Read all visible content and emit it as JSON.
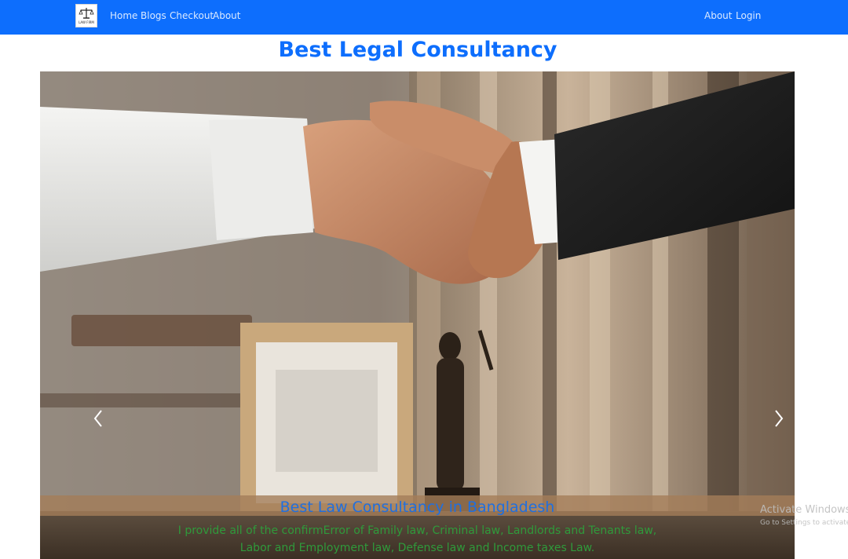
{
  "navbar": {
    "logo_text": "LAW FIRM",
    "left_links": [
      "Home",
      "Blogs",
      "Checkout",
      "About"
    ],
    "right_links": [
      "About",
      "Login"
    ],
    "color": "#0d6efd"
  },
  "main": {
    "page_title": "Best Legal Consultancy"
  },
  "carousel": {
    "image_description": "handshake-over-office-desk-photo",
    "prev_icon": "chevron-left-icon",
    "next_icon": "chevron-right-icon",
    "caption_title": "Best Law Consultancy in Bangladesh",
    "caption_text": "I provide all of the confirmError of Family law, Criminal law, Landlords and Tenants law, Labor and Employment law, Defense law and Income taxes Law.",
    "caption_title_color": "#1f6fe0",
    "caption_text_color": "#2f9a3b"
  },
  "watermark": {
    "title": "Activate Windows",
    "subtitle": "Go to Settings to activate"
  }
}
